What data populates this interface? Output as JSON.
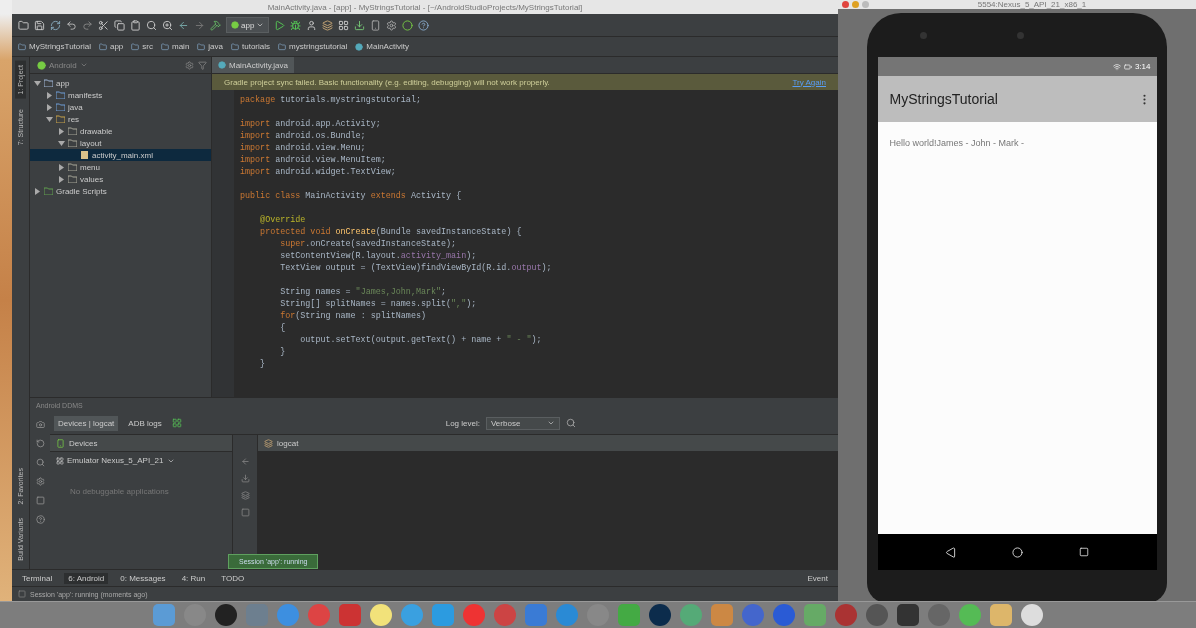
{
  "ide": {
    "title": "MainActivity.java - [app] - MyStringsTutorial - [~/AndroidStudioProjects/MyStringsTutorial]",
    "run_config": "app",
    "breadcrumbs": [
      "MyStringsTutorial",
      "app",
      "src",
      "main",
      "java",
      "tutorials",
      "mystringstutorial",
      "MainActivity"
    ],
    "side_tools": [
      {
        "label": "1: Project",
        "selected": true
      },
      {
        "label": "7: Structure",
        "selected": false
      }
    ],
    "lower_side_tools": [
      {
        "label": "2: Favorites",
        "selected": false
      },
      {
        "label": "Build Variants",
        "selected": false
      }
    ],
    "project": {
      "view": "Android",
      "tree": [
        {
          "label": "app",
          "kind": "module",
          "expanded": true,
          "selected": false,
          "children": [
            {
              "label": "manifests",
              "kind": "folder",
              "expanded": false,
              "selected": false
            },
            {
              "label": "java",
              "kind": "folder",
              "expanded": false,
              "selected": false
            },
            {
              "label": "res",
              "kind": "res",
              "expanded": true,
              "selected": false,
              "children": [
                {
                  "label": "drawable",
                  "kind": "plain",
                  "expanded": false,
                  "selected": false
                },
                {
                  "label": "layout",
                  "kind": "plain",
                  "expanded": true,
                  "selected": false,
                  "children": [
                    {
                      "label": "activity_main.xml",
                      "kind": "file",
                      "selected": true
                    }
                  ]
                },
                {
                  "label": "menu",
                  "kind": "plain",
                  "expanded": false,
                  "selected": false
                },
                {
                  "label": "values",
                  "kind": "plain",
                  "expanded": false,
                  "selected": false
                }
              ]
            }
          ]
        },
        {
          "label": "Gradle Scripts",
          "kind": "gradle",
          "expanded": false,
          "selected": false
        }
      ]
    },
    "editor": {
      "tabs": [
        {
          "label": "MainActivity.java",
          "selected": true
        }
      ],
      "banner": {
        "message": "Gradle project sync failed. Basic functionality (e.g. editing, debugging) will not work properly.",
        "action": "Try Again"
      },
      "code_blocks": [
        [
          [
            {
              "t": "package",
              "kind": "keyword"
            },
            {
              "t": " tutorials.mystringstutorial;",
              "kind": "plain"
            }
          ]
        ],
        [
          [
            {
              "t": "import",
              "kind": "keyword"
            },
            {
              "t": " android.app.Activity;",
              "kind": "plain"
            }
          ],
          [
            {
              "t": "import",
              "kind": "keyword"
            },
            {
              "t": " android.os.Bundle;",
              "kind": "plain"
            }
          ],
          [
            {
              "t": "import",
              "kind": "keyword"
            },
            {
              "t": " android.view.Menu;",
              "kind": "plain"
            }
          ],
          [
            {
              "t": "import",
              "kind": "keyword"
            },
            {
              "t": " android.view.MenuItem;",
              "kind": "plain"
            }
          ],
          [
            {
              "t": "import",
              "kind": "keyword"
            },
            {
              "t": " android.widget.TextView;",
              "kind": "plain"
            }
          ]
        ],
        [
          [
            {
              "t": "public class",
              "kind": "keyword"
            },
            {
              "t": " MainActivity ",
              "kind": "plain"
            },
            {
              "t": "extends",
              "kind": "keyword"
            },
            {
              "t": " Activity {",
              "kind": "plain"
            }
          ]
        ],
        [
          [
            {
              "t": "    @Override",
              "kind": "annotation"
            }
          ],
          [
            {
              "t": "    protected void ",
              "kind": "keyword"
            },
            {
              "t": "onCreate",
              "kind": "method"
            },
            {
              "t": "(Bundle savedInstanceState) {",
              "kind": "plain"
            }
          ],
          [
            {
              "t": "        super",
              "kind": "keyword"
            },
            {
              "t": ".onCreate(savedInstanceState);",
              "kind": "plain"
            }
          ],
          [
            {
              "t": "        setContentView(R.layout.",
              "kind": "plain"
            },
            {
              "t": "activity_main",
              "kind": "field"
            },
            {
              "t": ");",
              "kind": "plain"
            }
          ],
          [
            {
              "t": "        TextView output = (TextView)findViewById(R.id.",
              "kind": "plain"
            },
            {
              "t": "output",
              "kind": "field"
            },
            {
              "t": ");",
              "kind": "plain"
            }
          ]
        ],
        [
          [
            {
              "t": "        String names = ",
              "kind": "plain"
            },
            {
              "t": "\"James,John,Mark\"",
              "kind": "string"
            },
            {
              "t": ";",
              "kind": "plain"
            }
          ],
          [
            {
              "t": "        String[] splitNames = names.split(",
              "kind": "plain"
            },
            {
              "t": "\",\"",
              "kind": "string"
            },
            {
              "t": ");",
              "kind": "plain"
            }
          ],
          [
            {
              "t": "        for",
              "kind": "keyword"
            },
            {
              "t": "(String name : splitNames)",
              "kind": "plain"
            }
          ],
          [
            {
              "t": "        {",
              "kind": "plain"
            }
          ],
          [
            {
              "t": "            output.setText(output.getText() + name + ",
              "kind": "plain"
            },
            {
              "t": "\" - \"",
              "kind": "string"
            },
            {
              "t": ");",
              "kind": "plain"
            }
          ],
          [
            {
              "t": "        }",
              "kind": "plain"
            }
          ],
          [
            {
              "t": "    }",
              "kind": "plain"
            }
          ]
        ]
      ]
    },
    "ddms": {
      "title": "Android DDMS",
      "tabs": [
        {
          "label": "Devices | logcat",
          "selected": true
        },
        {
          "label": "ADB logs",
          "selected": false
        }
      ],
      "log_level_label": "Log level:",
      "log_level": "Verbose",
      "devices_header": "Devices",
      "device": "Emulator Nexus_5_API_21",
      "empty_message": "No debuggable applications",
      "logcat_header": "logcat",
      "tooltip": "Session 'app': running"
    },
    "tool_tabs": [
      {
        "label": "Terminal",
        "selected": false
      },
      {
        "label": "6: Android",
        "selected": true
      },
      {
        "label": "0: Messages",
        "selected": false
      },
      {
        "label": "4: Run",
        "selected": false
      },
      {
        "label": "TODO",
        "selected": false
      }
    ],
    "event_log": "Event",
    "status": "Session 'app': running (moments ago)"
  },
  "emulator": {
    "title": "5554:Nexus_5_API_21_x86_1",
    "time": "3:14",
    "app_title": "MyStringsTutorial",
    "output": "Hello world!James - John - Mark -"
  }
}
